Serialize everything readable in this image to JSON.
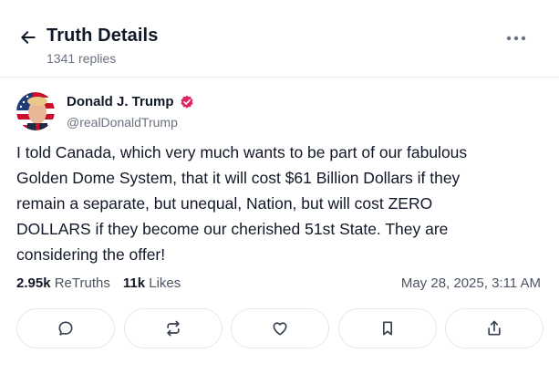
{
  "header": {
    "title": "Truth Details",
    "replies": "1341 replies"
  },
  "post": {
    "author_name": "Donald J. Trump",
    "handle": "@realDonaldTrump",
    "text": "I told Canada, which very much wants to be part of our fabulous\nGolden Dome System, that it will cost $61 Billion Dollars if they\nremain a separate, but unequal, Nation, but will cost ZERO\nDOLLARS if they become our cherished 51st State. They are\nconsidering the offer!",
    "retruths_count": "2.95k",
    "retruths_label": "ReTruths",
    "likes_count": "11k",
    "likes_label": "Likes",
    "timestamp": "May 28, 2025, 3:11 AM"
  },
  "icons": {
    "back": "arrow-left-icon",
    "more": "more-horizontal-icon",
    "verified": "verified-badge-icon",
    "reply": "reply-icon",
    "retruth": "retruth-icon",
    "like": "heart-icon",
    "bookmark": "bookmark-icon",
    "share": "share-icon"
  },
  "colors": {
    "verified_badge": "#e0245e",
    "text_primary": "#111827",
    "text_secondary": "#6b7280",
    "border": "#e5e7eb"
  }
}
